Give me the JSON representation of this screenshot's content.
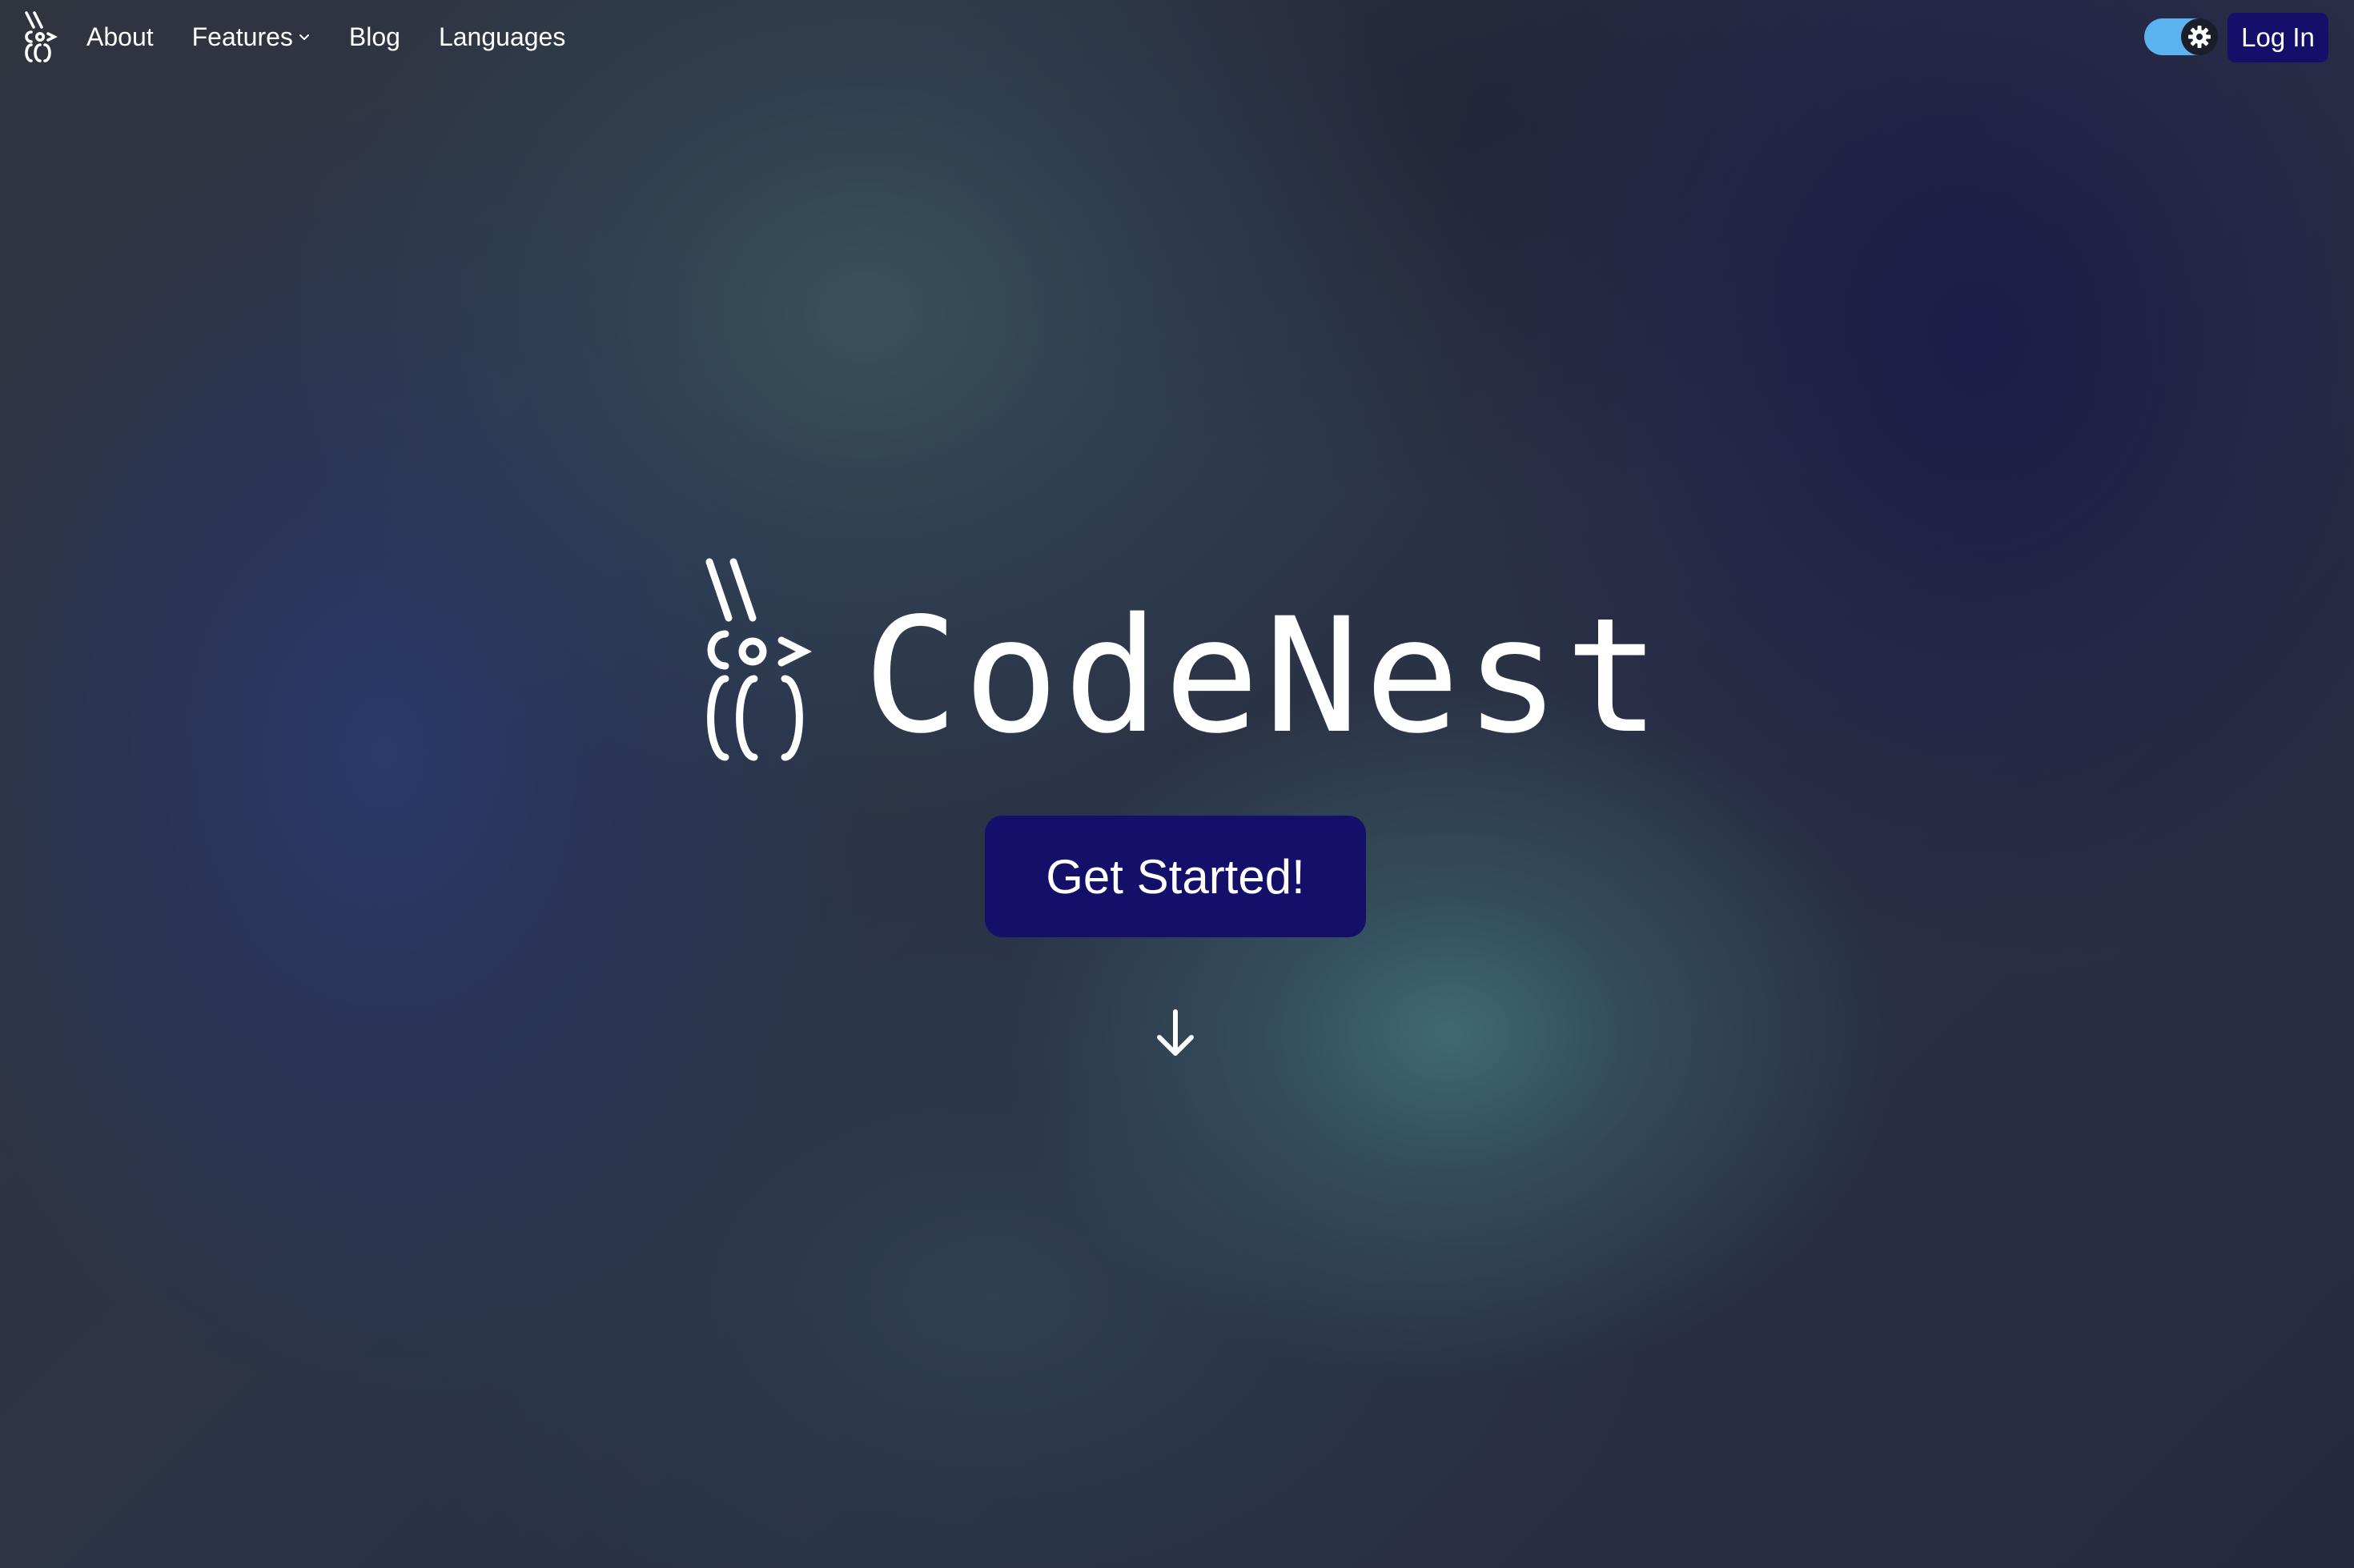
{
  "nav": {
    "logo_icon": "codenest-logo-icon",
    "links": [
      {
        "label": "About"
      },
      {
        "label": "Features",
        "icon": "chevron-down-icon"
      },
      {
        "label": "Blog"
      },
      {
        "label": "Languages"
      }
    ],
    "theme_toggle": {
      "icon": "gear-icon",
      "state": "on",
      "color": "#5bb2ee"
    },
    "login_label": "Log In"
  },
  "hero": {
    "logo_icon": "codenest-logo-icon",
    "title": "CodeNest",
    "cta_label": "Get Started!",
    "scroll_icon": "arrow-down-icon"
  },
  "colors": {
    "button_background": "#14106a",
    "text": "#ffffff",
    "toggle_track": "#5bb2ee",
    "background_dark": "#2a2d3d",
    "background_blue": "#2a3a6e",
    "background_teal": "#3e6470"
  }
}
